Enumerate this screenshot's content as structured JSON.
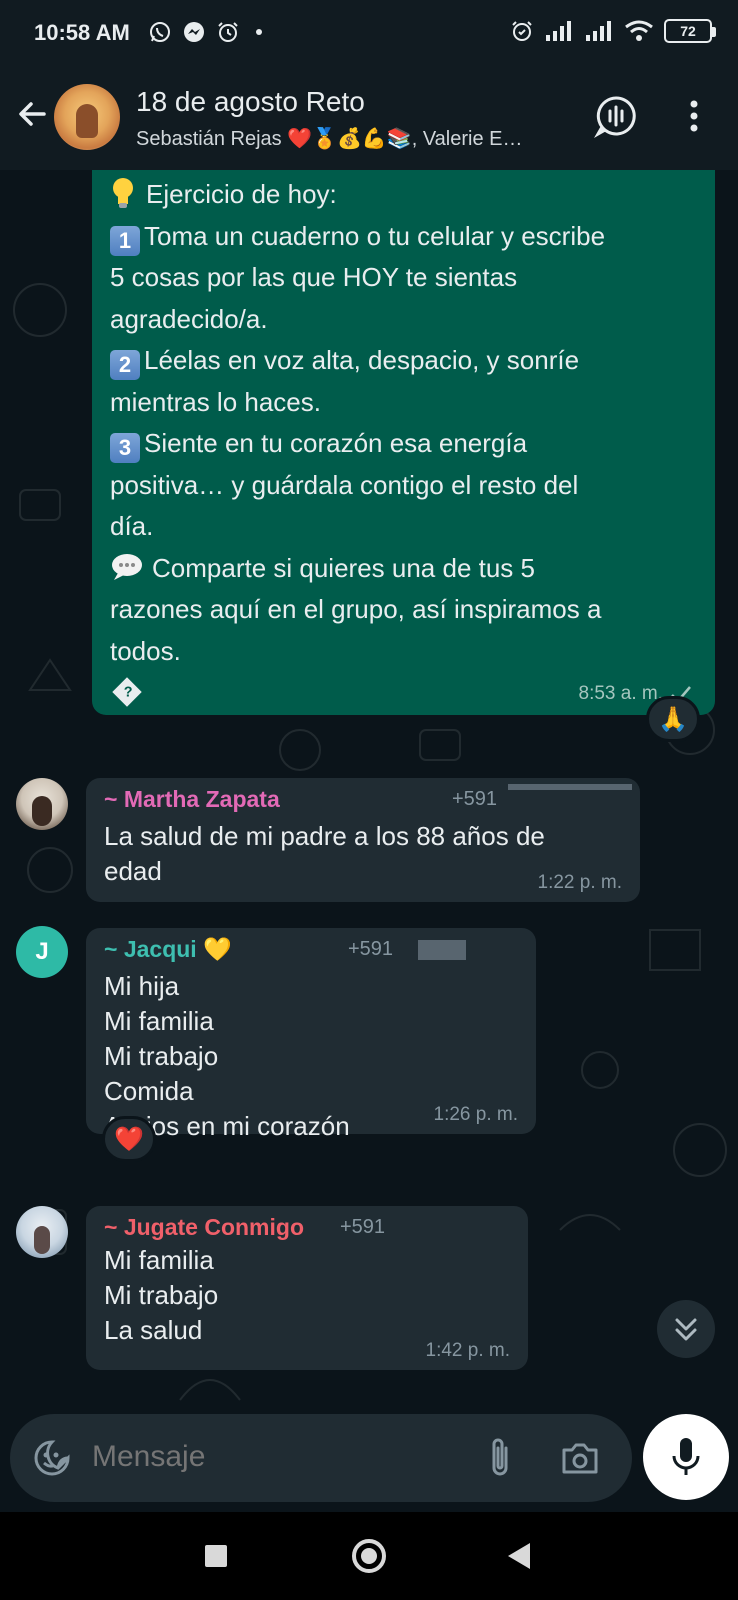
{
  "status_bar": {
    "time": "10:58 AM",
    "battery": "72"
  },
  "header": {
    "title": "18 de agosto Reto",
    "subtitle": "Sebastián Rejas  ❤️🏅💰💪📚, Valerie E…"
  },
  "outgoing_message": {
    "line1": "Ejercicio de hoy:",
    "step1_badge": "1",
    "step1_a": "Toma un cuaderno o tu celular y escribe",
    "step1_b": "5 cosas por las que HOY te sientas",
    "step1_c": "agradecido/a.",
    "step2_badge": "2",
    "step2_a": "Léelas en voz alta, despacio, y sonríe",
    "step2_b": "mientras lo haces.",
    "step3_badge": "3",
    "step3_a": "Siente en tu corazón esa energía",
    "step3_b": "positiva… y guárdala contigo el resto del",
    "step3_c": "día.",
    "share_a": "Comparte si quieres una de tus 5",
    "share_b": "razones aquí en el grupo, así inspiramos a",
    "share_c": "todos.",
    "time": "8:53 a. m.",
    "reaction": "🙏"
  },
  "messages": [
    {
      "sender": "~ Martha Zapata",
      "sender_color": "#e26ab6",
      "phone": "+591",
      "lines": [
        "La salud de mi padre a los 88 años de",
        "edad"
      ],
      "time": "1:22 p. m."
    },
    {
      "sender": "~ Jacqui 💛",
      "sender_color": "#3ebfb0",
      "avatar_letter": "J",
      "phone": "+591",
      "lines": [
        "Mi hija",
        "Mi familia",
        "Mi trabajo",
        "Comida",
        "A Dios en mi corazón"
      ],
      "time": "1:26 p. m.",
      "reaction": "❤️"
    },
    {
      "sender": "~ Jugate Conmigo",
      "sender_color": "#f0606a",
      "phone": "+591",
      "lines": [
        "Mi familia",
        "Mi trabajo",
        "La salud"
      ],
      "time": "1:42 p. m."
    }
  ],
  "input": {
    "placeholder": "Mensaje"
  },
  "colors": {
    "outgoing_bubble": "#005c4b",
    "incoming_bubble": "#202c33",
    "background": "#0b141a",
    "header": "#111b21"
  }
}
